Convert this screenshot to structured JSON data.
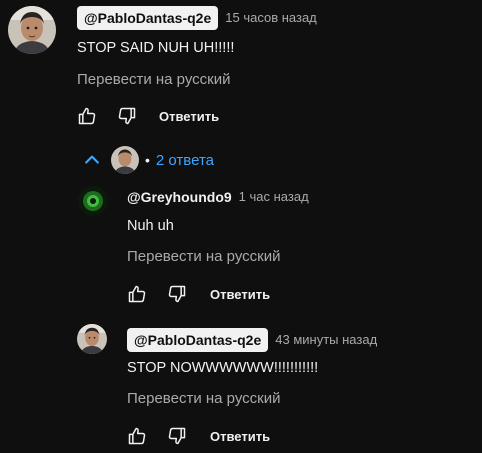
{
  "comment": {
    "author": "@PabloDantas-q2e",
    "time": "15 часов назад",
    "text": "STOP SAID NUH UH!!!!!",
    "translate_label": "Перевести на русский",
    "reply_label": "Ответить",
    "like_icon": "thumb-up-outline",
    "dislike_icon": "thumb-down-outline"
  },
  "replies_toggle": {
    "chevron_icon": "chevron-up",
    "bullet": "•",
    "count_label": "2 ответа",
    "color": "#3ea6ff"
  },
  "replies": [
    {
      "author": "@Greyhoundo9",
      "time": "1 час назад",
      "text": "Nuh uh",
      "translate_label": "Перевести на русский",
      "reply_label": "Ответить"
    },
    {
      "author": "@PabloDantas-q2e",
      "time": "43 минуты назад",
      "text": "STOP NOWWWWWW!!!!!!!!!!!",
      "translate_label": "Перевести на русский",
      "reply_label": "Ответить"
    }
  ],
  "colors": {
    "background": "#0f0f0f",
    "text": "#f1f1f1",
    "secondary": "#aaaaaa",
    "link": "#3ea6ff",
    "author_pill_bg": "#f1f1f1"
  }
}
